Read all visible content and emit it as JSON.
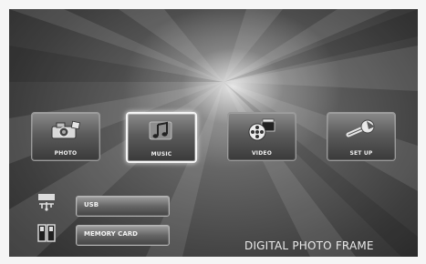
{
  "menu": {
    "tiles": [
      {
        "label": "PHOTO",
        "icon": "camera-icon",
        "selected": false
      },
      {
        "label": "MUSIC",
        "icon": "music-note-icon",
        "selected": true
      },
      {
        "label": "VIDEO",
        "icon": "film-reel-icon",
        "selected": false
      },
      {
        "label": "SET UP",
        "icon": "wrench-icon",
        "selected": false
      }
    ]
  },
  "sources": {
    "usb_label": "USB",
    "card_label": "MEMORY CARD"
  },
  "brand_text": "DIGITAL PHOTO FRAME",
  "colors": {
    "background_dark": "#1a1a1a",
    "highlight": "#f5f5f5",
    "tile_gray": "#5b5b5b"
  }
}
